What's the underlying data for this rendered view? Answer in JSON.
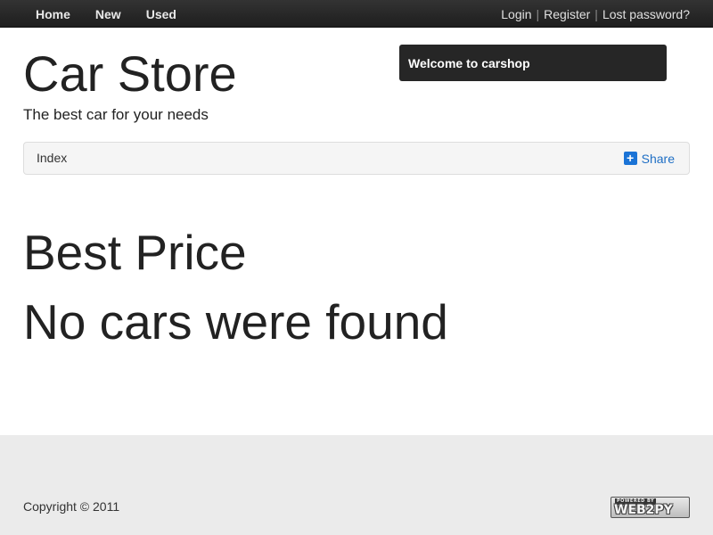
{
  "navbar": {
    "links": [
      "Home",
      "New",
      "Used"
    ],
    "auth": {
      "login": "Login",
      "register": "Register",
      "lost_password": "Lost password?",
      "separator": "|"
    }
  },
  "header": {
    "title": "Car Store",
    "subtitle": "The best car for your needs",
    "welcome": "Welcome to carshop"
  },
  "breadcrumb": {
    "current": "Index",
    "share_label": "Share",
    "share_icon": "plus-square-icon",
    "share_color": "#1a73d6"
  },
  "main": {
    "heading": "Best Price",
    "message": "No cars were found"
  },
  "footer": {
    "copyright": "Copyright © 2011",
    "badge_top": "POWERED BY",
    "badge_main": "WEB2PY"
  },
  "colors": {
    "navbar": "#222222",
    "welcome_box": "#262626",
    "footer_bg": "#ebebeb",
    "link": "#1f6fc5"
  }
}
